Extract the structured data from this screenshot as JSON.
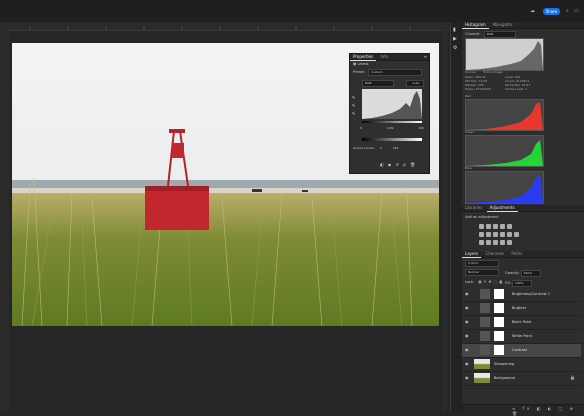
{
  "topbar": {
    "share_label": "Share"
  },
  "histogram": {
    "tabs": [
      "Histogram",
      "Navigator"
    ],
    "channel_label": "Channel:",
    "channel_value": "RGB",
    "source_label": "Source:",
    "source_value": "Entire Image",
    "stats_left": [
      "Mean: 189.32",
      "Std Dev: 79.45",
      "Median: 236",
      "Pixels: 23726400"
    ],
    "stats_right": [
      "Level: 241",
      "Count: 2123811",
      "Percentile: 90.47",
      "Cache Level: 1"
    ],
    "channels": [
      {
        "name": "Red",
        "color": "#e8382e"
      },
      {
        "name": "Green",
        "color": "#22d636"
      },
      {
        "name": "Blue",
        "color": "#2b3cf0"
      }
    ]
  },
  "properties": {
    "tabs": [
      "Properties",
      "Info"
    ],
    "title": "Levels",
    "preset_label": "Preset:",
    "preset_value": "Custom",
    "channel_value": "RGB",
    "auto_label": "Auto",
    "input_levels": [
      "0",
      "0.99",
      "209"
    ],
    "output_label": "Output Levels:",
    "output_levels": [
      "0",
      "255"
    ]
  },
  "adjustments": {
    "tabs": [
      "Libraries",
      "Adjustments"
    ],
    "add_label": "Add an adjustment"
  },
  "layers": {
    "tabs": [
      "Layers",
      "Channels",
      "Paths"
    ],
    "kind_label": "Q Kind",
    "blend_mode": "Normal",
    "opacity_label": "Opacity:",
    "opacity_value": "100%",
    "lock_label": "Lock:",
    "fill_label": "Fill:",
    "fill_value": "100%",
    "items": [
      {
        "name": "Brightness/Contrast 1",
        "type": "adjustment"
      },
      {
        "name": "Brighter",
        "type": "adjustment"
      },
      {
        "name": "Black Point",
        "type": "adjustment"
      },
      {
        "name": "White Point",
        "type": "adjustment"
      },
      {
        "name": "Contrast",
        "type": "adjustment",
        "selected": true
      },
      {
        "name": "Sharpening",
        "type": "pixel"
      },
      {
        "name": "Background",
        "type": "pixel",
        "locked": true
      }
    ]
  }
}
